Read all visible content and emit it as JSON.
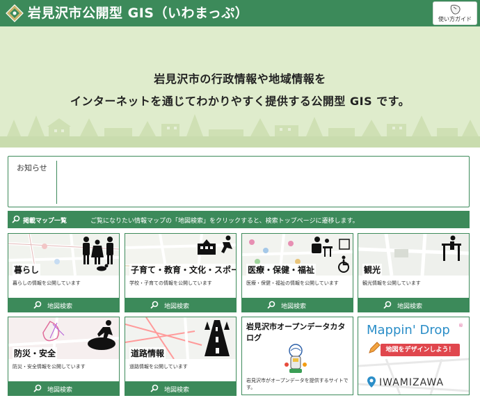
{
  "header": {
    "title": "岩見沢市公開型 GIS（いわまっぷ）",
    "guide_label": "使い方ガイド"
  },
  "hero": {
    "line1": "岩見沢市の行政情報や地域情報を",
    "line2": "インターネットを通じてわかりやすく提供する公開型 GIS です。"
  },
  "notice": {
    "label": "お知らせ"
  },
  "map_list": {
    "title": "掲載マップ一覧",
    "description": "ご覧になりたい情報マップの「地図検索」をクリックすると、検索トップページに遷移します。"
  },
  "cards": [
    {
      "title": "暮らし",
      "description": "暮らしの情報を公開しています",
      "button": "地図検索",
      "icon": "family-icon"
    },
    {
      "title": "子育て・教育・文化・スポーツ",
      "description": "学校・子育ての情報を公開しています",
      "button": "地図検索",
      "icon": "school-icon"
    },
    {
      "title": "医療・保健・福祉",
      "description": "医療・保健・福祉の情報を公開しています",
      "button": "地図検索",
      "icon": "medical-icon"
    },
    {
      "title": "観光",
      "description": "観光情報を公開しています",
      "button": "地図検索",
      "icon": "tourism-icon"
    },
    {
      "title": "防災・安全",
      "description": "防災・安全情報を公開しています",
      "button": "地図検索",
      "icon": "evacuation-icon"
    },
    {
      "title": "道路情報",
      "description": "道路情報を公開しています",
      "button": "地図検索",
      "icon": "road-icon"
    }
  ],
  "open_data": {
    "title": "岩見沢市オープンデータカタログ",
    "description": "岩見沢市がオープンデータを提供するサイトです。"
  },
  "mappin": {
    "logo_text": "Mappin' Drop",
    "registered": "®",
    "banner": "地図をデザインしよう！",
    "city": "IWAMIZAWA"
  },
  "colors": {
    "accent": "#3c8a5a",
    "hero_bg": "#dfeccc"
  }
}
